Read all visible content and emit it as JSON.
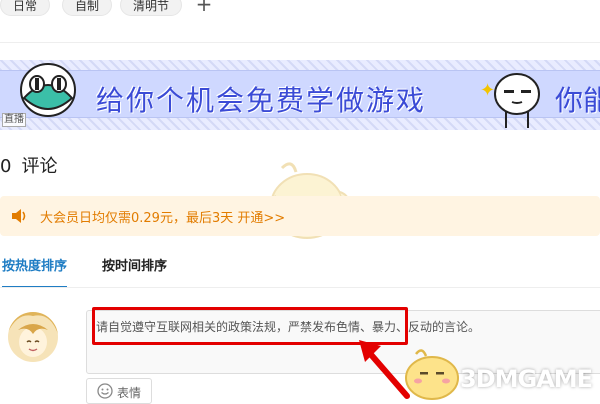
{
  "tags": [
    "日常",
    "自制",
    "清明节"
  ],
  "add_tag_label": "+",
  "banner": {
    "main_text": "给你个机会免费学做游戏",
    "trailing_text": "你能",
    "corner_mark": "直播"
  },
  "comments": {
    "count": "0",
    "title": "评论"
  },
  "vip": {
    "text": "大会员日均仅需0.29元，最后3天 开通>>",
    "accent": "#e27c00"
  },
  "sort_tabs": [
    "按热度排序",
    "按时间排序"
  ],
  "comment_input": {
    "placeholder": "请自觉遵守互联网相关的政策法规，严禁发布色情、暴力、反动的言论。"
  },
  "emoji_button": {
    "label": "表情"
  },
  "watermark_text": "3DMGAME",
  "colors": {
    "tab_active": "#1f7dc4",
    "highlight": "#e30000",
    "vip_bg": "#fff4e2"
  }
}
